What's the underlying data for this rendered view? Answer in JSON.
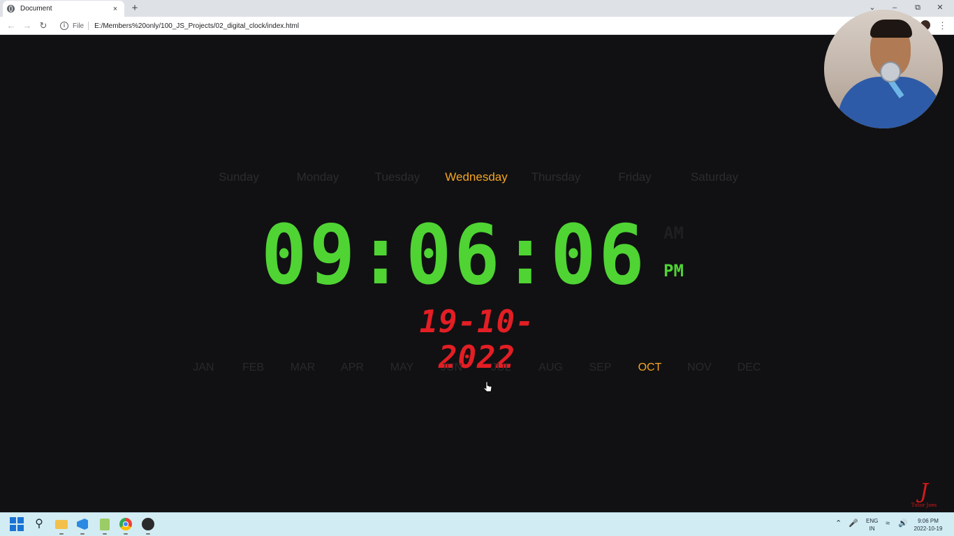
{
  "browser": {
    "tab_title": "Document",
    "tab_close": "×",
    "new_tab": "+",
    "file_label": "File",
    "url": "E:/Members%20only/100_JS_Projects/02_digital_clock/index.html",
    "window_controls": {
      "minimize": "–",
      "maximize": "⧉",
      "close": "✕",
      "dropdown": "⌄"
    }
  },
  "clock_page": {
    "days": [
      "Sunday",
      "Monday",
      "Tuesday",
      "Wednesday",
      "Thursday",
      "Friday",
      "Saturday"
    ],
    "active_day": "Wednesday",
    "time": "09:06:06",
    "am_label": "AM",
    "pm_label": "PM",
    "active_period": "PM",
    "date": "19-10-2022",
    "months": [
      "JAN",
      "FEB",
      "MAR",
      "APR",
      "MAY",
      "JUN",
      "JUL",
      "AUG",
      "SEP",
      "OCT",
      "NOV",
      "DEC"
    ],
    "active_month": "OCT"
  },
  "overlay": {
    "logo_text": "Tutor Joes"
  },
  "taskbar": {
    "lang_line1": "ENG",
    "lang_line2": "IN",
    "time": "9:06 PM",
    "date": "2022-10-19"
  },
  "colors": {
    "background": "#111113",
    "digit_green": "#4fd433",
    "date_red": "#e31e24",
    "active_gold": "#f5a524",
    "inactive_text": "#2c2c2f"
  },
  "icons": [
    "back-icon",
    "forward-icon",
    "reload-icon",
    "info-icon",
    "search-icon",
    "folder-icon",
    "vscode-icon",
    "notepad-icon",
    "chrome-icon",
    "obs-icon",
    "wifi-icon",
    "volume-icon",
    "mic-icon"
  ]
}
